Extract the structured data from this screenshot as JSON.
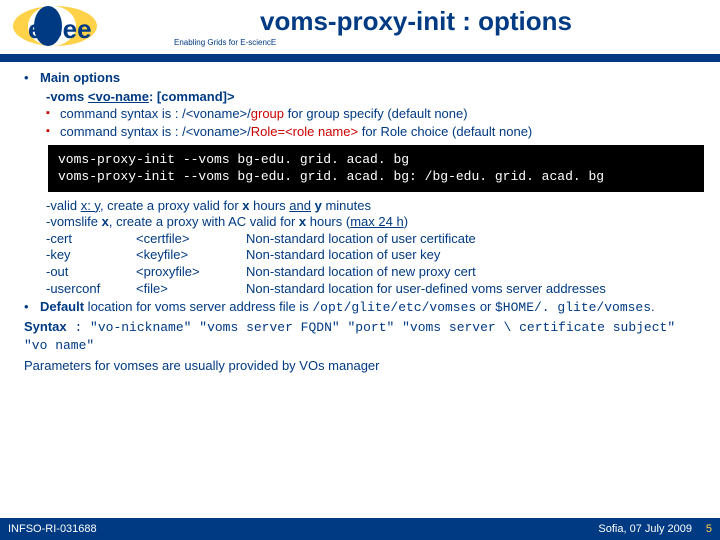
{
  "header": {
    "title": "voms-proxy-init : options",
    "tagline": "Enabling Grids for E-sciencE",
    "logo_text": "eGee"
  },
  "main": {
    "h1": "Main options",
    "voms_opt_a": "-voms ",
    "voms_opt_b": "<vo-name",
    "voms_opt_c": ": [command]>",
    "sub1_a": "command syntax is : /<voname>/",
    "sub1_b": "group",
    "sub1_c": " for group specify (default none)",
    "sub2_a": "command syntax is : /<voname>/",
    "sub2_b": "Role=<role name>",
    "sub2_c": " for Role choice (default none)",
    "code1": "voms-proxy-init --voms bg-edu. grid. acad. bg",
    "code2": "voms-proxy-init --voms bg-edu. grid. acad. bg: /bg-edu. grid. acad. bg",
    "valid_a": "-valid ",
    "valid_b": "x: y",
    "valid_c": ", create a proxy valid for ",
    "valid_d": "x",
    "valid_e": " hours ",
    "valid_f": "and",
    "valid_g": " y",
    "valid_h": " minutes",
    "life_a": "-vomslife ",
    "life_b": "x",
    "life_c": ", create a proxy with AC valid for ",
    "life_d": "x",
    "life_e": " hours (",
    "life_f": "max 24 h",
    "life_g": ")",
    "cert_o": "-cert",
    "cert_p": "<certfile>",
    "cert_d": "Non-standard location of user certificate",
    "key_o": "-key",
    "key_p": "<keyfile>",
    "key_d": "Non-standard location of user key",
    "out_o": "-out",
    "out_p": "<proxyfile>",
    "out_d": "Non-standard location of new proxy cert",
    "uc_o": "-userconf",
    "uc_p": "<file>",
    "uc_d": "Non-standard location for user-defined voms server addresses",
    "def_a": "Default",
    "def_b": " location for voms server address file is ",
    "def_c": "/opt/glite/etc/vomses",
    "def_d": " or ",
    "def_e": "$HOME/. glite/vomses",
    "def_f": ".",
    "syntax_l": "Syntax",
    "syntax_v": " : \"vo-nickname\" \"voms server FQDN\" \"port\" \"voms server \\ certificate subject\" \"vo name\"",
    "params": "Parameters for vomses are usually provided by VOs manager"
  },
  "footer": {
    "left": "INFSO-RI-031688",
    "right": "Sofia, 07 July 2009",
    "num": "5"
  }
}
